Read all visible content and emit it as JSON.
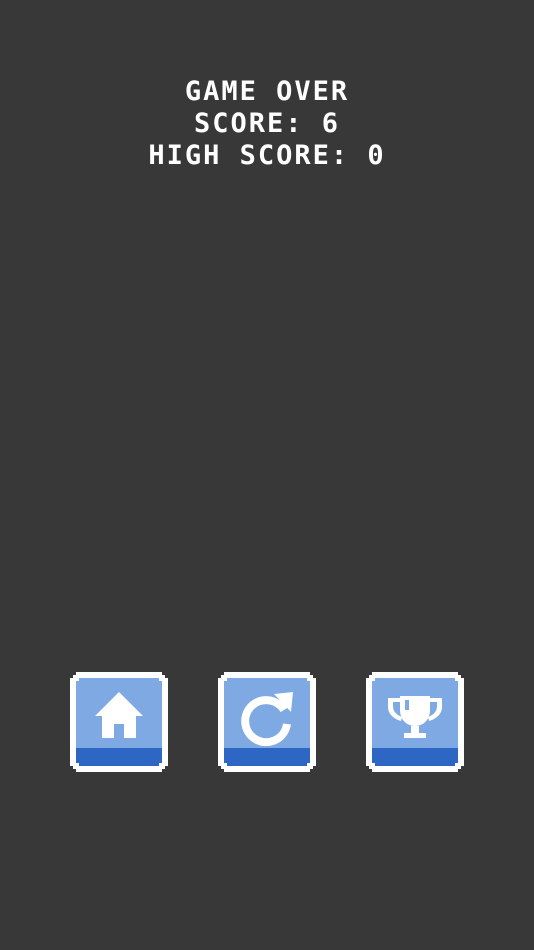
{
  "game_over": {
    "title": "GAME OVER",
    "score_line": "SCORE: 6",
    "high_score_line": "HIGH SCORE: 0"
  },
  "buttons": [
    {
      "icon": "home-icon"
    },
    {
      "icon": "restart-icon"
    },
    {
      "icon": "trophy-icon"
    }
  ],
  "colors": {
    "background": "#383838",
    "button_face": "#7ea9e3",
    "button_base": "#2e66c4",
    "button_border": "#ffffff",
    "text": "#ffffff"
  }
}
